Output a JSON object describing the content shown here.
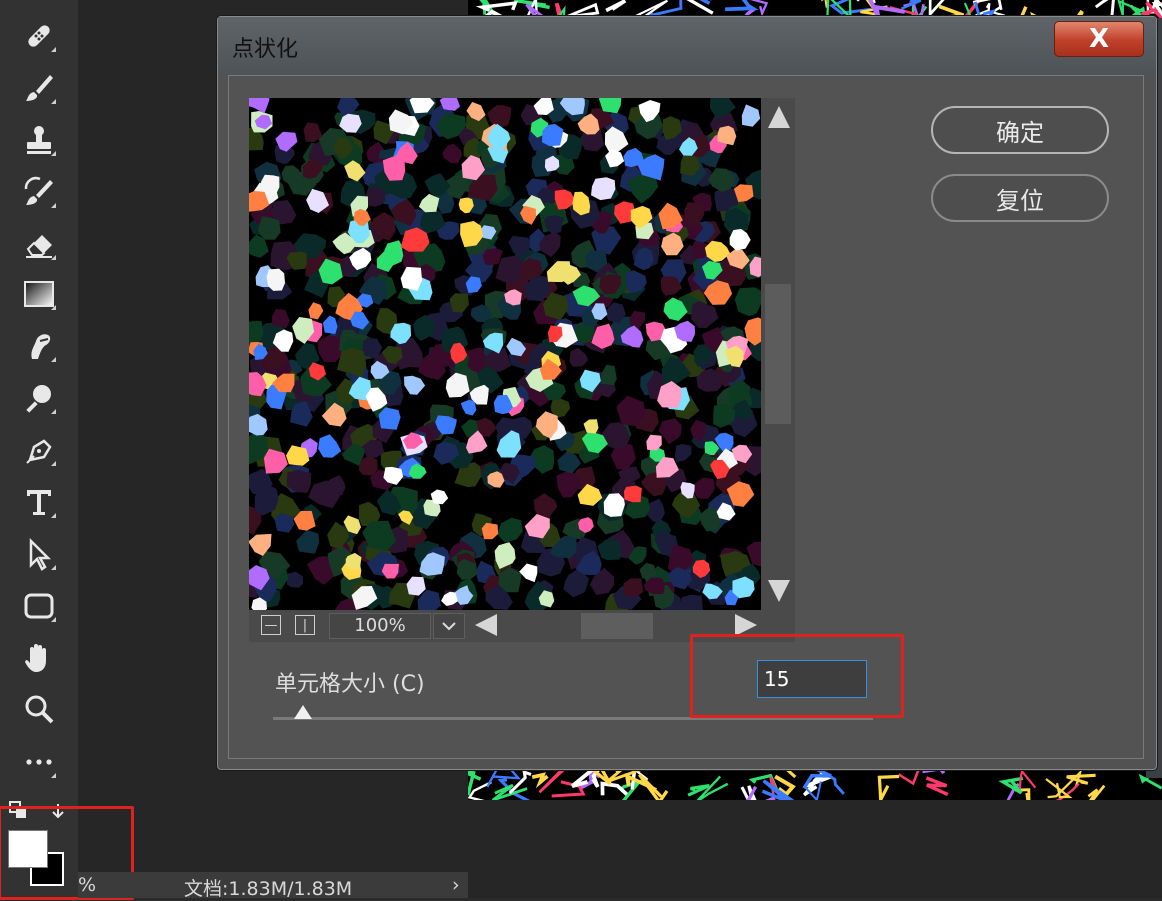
{
  "dialog": {
    "title": "点状化",
    "close_label": "X",
    "ok_label": "确定",
    "reset_label": "复位",
    "zoom_value": "100%",
    "cell_size_label": "单元格大小 (C)",
    "cell_size_value": "15",
    "slider_fraction": 0.05
  },
  "status_bar": {
    "percent": "%",
    "doc_info": "文档:1.83M/1.83M",
    "arrow": "›"
  },
  "colors": {
    "foreground": "#ffffff",
    "background": "#000000",
    "highlight": "#e0221e"
  },
  "toolbar": {
    "tools": [
      "healing-brush-icon",
      "brush-icon",
      "clone-stamp-icon",
      "history-brush-icon",
      "eraser-icon",
      "gradient-icon",
      "smudge-icon",
      "dodge-icon",
      "pen-icon",
      "type-icon",
      "path-select-icon",
      "rectangle-icon",
      "hand-icon",
      "zoom-icon",
      "more-icon"
    ]
  }
}
